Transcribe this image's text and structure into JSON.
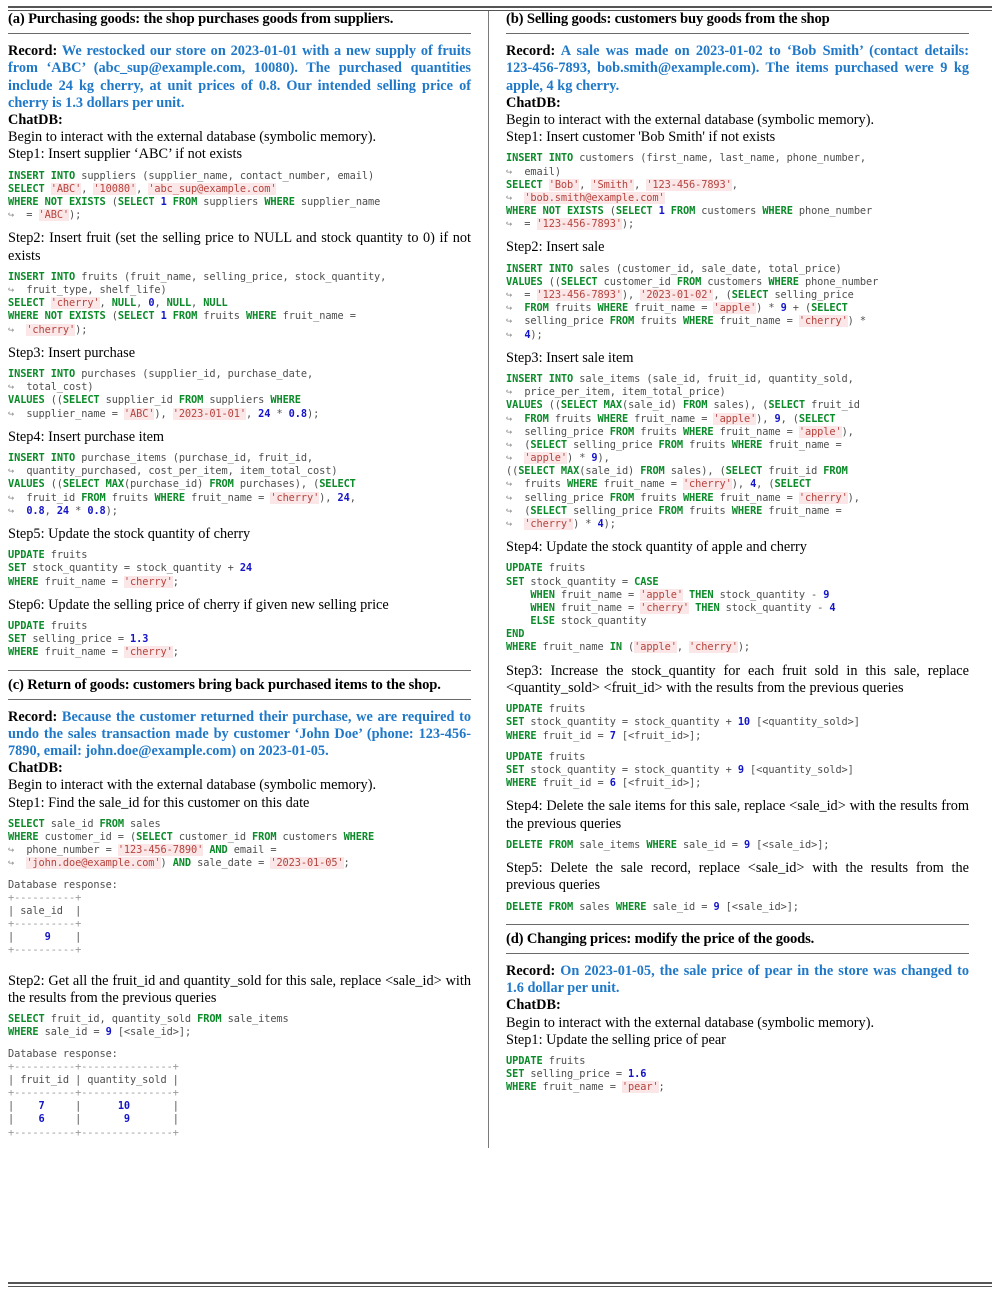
{
  "figure": {
    "panels": [
      {
        "id": "a",
        "title": "(a) Purchasing goods: the shop purchases goods from suppliers.",
        "record_label": "Record:",
        "record_text": "We restocked our store on 2023-01-01 with a new supply of fruits from ‘ABC’ (abc_sup@example.com, 10080). The purchased quantities include 24 kg cherry, at unit prices of 0.8. Our intended selling price of cherry is 1.3 dollars per unit.",
        "chatdb_label": "ChatDB:",
        "intro": "Begin to interact with the external database (symbolic memory).",
        "steps": [
          {
            "label": "Step1: Insert supplier ‘ABC’ if not exists"
          },
          {
            "label": "Step2: Insert fruit (set the selling price to NULL and stock quantity to 0) if not exists"
          },
          {
            "label": "Step3: Insert purchase"
          },
          {
            "label": "Step4: Insert purchase item"
          },
          {
            "label": "Step5: Update the stock quantity of cherry"
          },
          {
            "label": "Step6: Update the selling price of cherry if given new selling price"
          }
        ]
      },
      {
        "id": "b",
        "title": "(b) Selling goods: customers buy goods from the shop",
        "record_label": "Record:",
        "record_text": "A sale was made on 2023-01-02 to ‘Bob Smith’ (contact details: 123-456-7893, bob.smith@example.com). The items purchased were 9 kg apple, 4 kg cherry.",
        "chatdb_label": "ChatDB:",
        "intro": "Begin to interact with the external database (symbolic memory).",
        "steps": [
          {
            "label": "Step1: Insert customer 'Bob Smith' if not exists"
          },
          {
            "label": "Step2: Insert sale"
          },
          {
            "label": "Step3: Insert sale item"
          },
          {
            "label": "Step4: Update the stock quantity of apple and cherry"
          }
        ]
      },
      {
        "id": "c",
        "title": "(c) Return of goods: customers bring back purchased items to the shop.",
        "record_label": "Record:",
        "record_text": "Because the customer returned their purchase, we are required to undo the sales transaction made by customer ‘John Doe’ (phone: 123-456-7890, email: john.doe@example.com) on 2023-01-05.",
        "chatdb_label": "ChatDB:",
        "intro": "Begin to interact with the external database (symbolic memory).",
        "steps": [
          {
            "label": "Step1: Find the sale_id for this customer on this date"
          },
          {
            "label": "Step2: Get all the fruit_id and quantity_sold for this sale, replace <sale_id> with the results from the previous queries"
          },
          {
            "label": "Step3: Increase the stock_quantity for each fruit sold in this sale, replace <quantity_sold> <fruit_id> with the results from the previous queries"
          },
          {
            "label": "Step4: Delete the sale items for this sale, replace <sale_id> with the results from the previous queries"
          },
          {
            "label": "Step5: Delete the sale record, replace <sale_id> with the results from the previous queries"
          }
        ],
        "db_response_label": "Database response:",
        "db_tables": [
          {
            "columns": [
              "sale_id"
            ],
            "rows": [
              [
                "9"
              ]
            ]
          },
          {
            "columns": [
              "fruit_id",
              "quantity_sold"
            ],
            "rows": [
              [
                "7",
                "10"
              ],
              [
                "6",
                "9"
              ]
            ]
          }
        ]
      },
      {
        "id": "d",
        "title": "(d) Changing prices: modify the price of the goods.",
        "record_label": "Record:",
        "record_text": "On 2023-01-05, the sale price of pear in the store was changed to 1.6 dollar per unit.",
        "chatdb_label": "ChatDB:",
        "intro": "Begin to interact with the external database (symbolic memory).",
        "steps": [
          {
            "label": "Step1: Update the selling price of pear"
          }
        ]
      }
    ]
  },
  "code": {
    "a1": "INSERT INTO suppliers (supplier_name, contact_number, email)\nSELECT 'ABC', '10080', 'abc_sup@example.com'\nWHERE NOT EXISTS (SELECT 1 FROM suppliers WHERE supplier_name\n↪  = 'ABC');",
    "a2": "INSERT INTO fruits (fruit_name, selling_price, stock_quantity,\n↪  fruit_type, shelf_life)\nSELECT 'cherry', NULL, 0, NULL, NULL\nWHERE NOT EXISTS (SELECT 1 FROM fruits WHERE fruit_name =\n↪  'cherry');",
    "a3": "INSERT INTO purchases (supplier_id, purchase_date,\n↪  total_cost)\nVALUES ((SELECT supplier_id FROM suppliers WHERE\n↪  supplier_name = 'ABC'), '2023-01-01', 24 * 0.8);",
    "a4": "INSERT INTO purchase_items (purchase_id, fruit_id,\n↪  quantity_purchased, cost_per_item, item_total_cost)\nVALUES ((SELECT MAX(purchase_id) FROM purchases), (SELECT\n↪  fruit_id FROM fruits WHERE fruit_name = 'cherry'), 24,\n↪  0.8, 24 * 0.8);",
    "a5": "UPDATE fruits\nSET stock_quantity = stock_quantity + 24\nWHERE fruit_name = 'cherry';",
    "a6": "UPDATE fruits\nSET selling_price = 1.3\nWHERE fruit_name = 'cherry';",
    "b1": "INSERT INTO customers (first_name, last_name, phone_number,\n↪  email)\nSELECT 'Bob', 'Smith', '123-456-7893',\n↪  'bob.smith@example.com'\nWHERE NOT EXISTS (SELECT 1 FROM customers WHERE phone_number\n↪  = '123-456-7893');",
    "b2": "INSERT INTO sales (customer_id, sale_date, total_price)\nVALUES ((SELECT customer_id FROM customers WHERE phone_number\n↪  = '123-456-7893'), '2023-01-02', (SELECT selling_price\n↪  FROM fruits WHERE fruit_name = 'apple') * 9 + (SELECT\n↪  selling_price FROM fruits WHERE fruit_name = 'cherry') *\n↪  4);",
    "b3": "INSERT INTO sale_items (sale_id, fruit_id, quantity_sold,\n↪  price_per_item, item_total_price)\nVALUES ((SELECT MAX(sale_id) FROM sales), (SELECT fruit_id\n↪  FROM fruits WHERE fruit_name = 'apple'), 9, (SELECT\n↪  selling_price FROM fruits WHERE fruit_name = 'apple'),\n↪  (SELECT selling_price FROM fruits WHERE fruit_name =\n↪  'apple') * 9),\n((SELECT MAX(sale_id) FROM sales), (SELECT fruit_id FROM\n↪  fruits WHERE fruit_name = 'cherry'), 4, (SELECT\n↪  selling_price FROM fruits WHERE fruit_name = 'cherry'),\n↪  (SELECT selling_price FROM fruits WHERE fruit_name =\n↪  'cherry') * 4);",
    "b4": "UPDATE fruits\nSET stock_quantity = CASE\n    WHEN fruit_name = 'apple' THEN stock_quantity - 9\n    WHEN fruit_name = 'cherry' THEN stock_quantity - 4\n    ELSE stock_quantity\nEND\nWHERE fruit_name IN ('apple', 'cherry');",
    "c1": "SELECT sale_id FROM sales\nWHERE customer_id = (SELECT customer_id FROM customers WHERE\n↪  phone_number = '123-456-7890' AND email =\n↪  'john.doe@example.com') AND sale_date = '2023-01-05';",
    "c1_db": "Database response:\n+----------+\n| sale_id  |\n+----------+\n|     9    |\n+----------+",
    "c2": "SELECT fruit_id, quantity_sold FROM sale_items\nWHERE sale_id = 9 [<sale_id>];",
    "c2_db": "Database response:\n+----------+---------------+\n| fruit_id | quantity_sold |\n+----------+---------------+\n|    7     |      10       |\n|    6     |       9       |\n+----------+---------------+",
    "c3a": "UPDATE fruits\nSET stock_quantity = stock_quantity + 10 [<quantity_sold>]\nWHERE fruit_id = 7 [<fruit_id>];",
    "c3b": "UPDATE fruits\nSET stock_quantity = stock_quantity + 9 [<quantity_sold>]\nWHERE fruit_id = 6 [<fruit_id>];",
    "c4": "DELETE FROM sale_items WHERE sale_id = 9 [<sale_id>];",
    "c5": "DELETE FROM sales WHERE sale_id = 9 [<sale_id>];",
    "d1": "UPDATE fruits\nSET selling_price = 1.6\nWHERE fruit_name = 'pear';"
  },
  "colors": {
    "record_blue": "#1f78c8",
    "keyword_green": "#0a8a28",
    "string_red": "#b5443f",
    "string_bg": "#fbe7e7",
    "number_blue": "#1414c8",
    "code_gray": "#4f4f4f"
  }
}
